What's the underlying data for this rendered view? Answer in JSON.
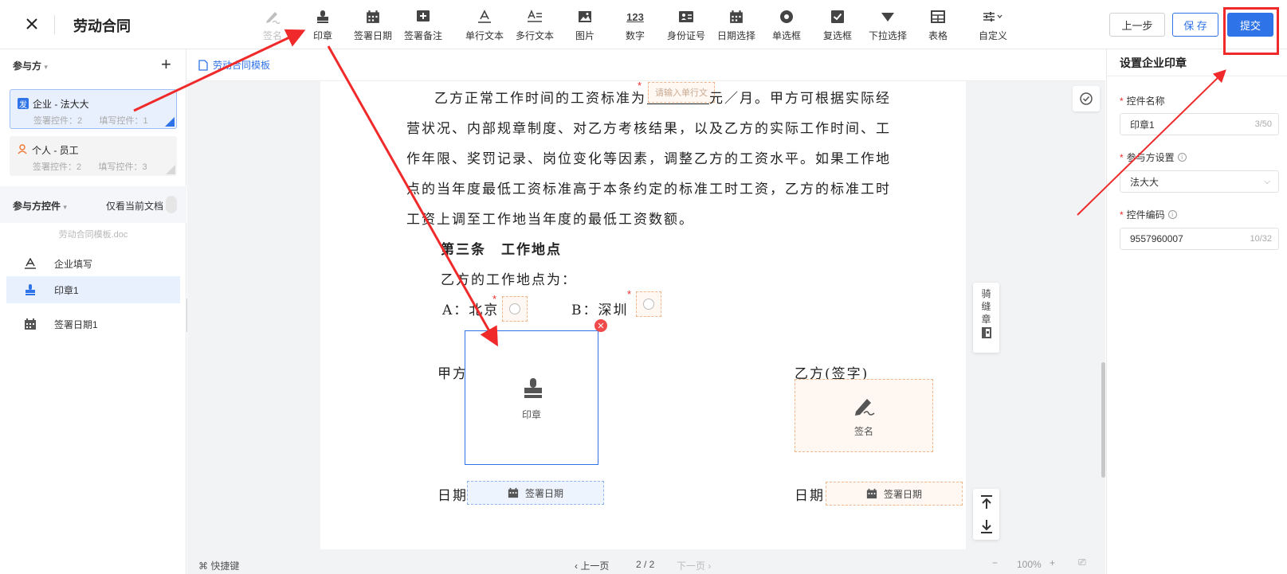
{
  "header": {
    "title": "劳动合同",
    "prev": "上一步",
    "save": "保 存",
    "submit": "提交"
  },
  "toolbar": [
    {
      "label": "签名",
      "icon": "pen-icon",
      "disabled": true
    },
    {
      "label": "印章",
      "icon": "stamp-icon"
    },
    {
      "label": "签署日期",
      "icon": "calendar-icon"
    },
    {
      "label": "签署备注",
      "icon": "plus-box-icon"
    },
    {
      "label": "单行文本",
      "icon": "single-line-text-icon"
    },
    {
      "label": "多行文本",
      "icon": "multi-line-text-icon"
    },
    {
      "label": "图片",
      "icon": "image-icon"
    },
    {
      "label": "数字",
      "icon": "number-icon",
      "glyph": "123"
    },
    {
      "label": "身份证号",
      "icon": "id-card-icon"
    },
    {
      "label": "日期选择",
      "icon": "calendar-icon"
    },
    {
      "label": "单选框",
      "icon": "radio-icon"
    },
    {
      "label": "复选框",
      "icon": "checkbox-icon"
    },
    {
      "label": "下拉选择",
      "icon": "dropdown-icon"
    },
    {
      "label": "表格",
      "icon": "table-icon"
    },
    {
      "label": "自定义",
      "icon": "custom-icon"
    }
  ],
  "sidebar": {
    "participants_title": "参与方",
    "participants": [
      {
        "tag": "发",
        "name": "企业 - 法大大",
        "sign_count": "签署控件：2",
        "fill_count": "填写控件：1"
      },
      {
        "name": "个人 - 员工",
        "sign_count": "签署控件：2",
        "fill_count": "填写控件：3"
      }
    ],
    "controls_title": "参与方控件",
    "only_current": "仅看当前文档",
    "doc_name": "劳动合同模板.doc",
    "controls": [
      {
        "label": "企业填写",
        "icon": "text-icon"
      },
      {
        "label": "印章1",
        "icon": "stamp-icon"
      },
      {
        "label": "签署日期1",
        "icon": "calendar-icon"
      }
    ]
  },
  "tab": {
    "label": "劳动合同模板"
  },
  "document": {
    "lines": [
      "乙方正常工作时间的工资标准为",
      "营状况、内部规章制度、对乙方考核结果，以及乙方的实际工作时间、工",
      "作年限、奖罚记录、岗位变化等因素，调整乙方的工资水平。如果工作地",
      "点的当年度最低工资标准高于本条约定的标准工时工资，乙方的标准工时",
      "工资上调至工作地当年度的最低工资数额。"
    ],
    "line1_tail": "元／月。甲方可根据实际经",
    "placeholder": "请输入单行文",
    "article": "第三条　工作地点",
    "place_intro": "乙方的工作地点为：",
    "option_a": "A：北京",
    "option_b": "B：深圳",
    "party_a": "甲方",
    "party_b": "乙方(签字)",
    "date_a": "日期",
    "date_b": "日期",
    "stamp_label": "印章",
    "sign_label": "签名",
    "date_field_a": "签署日期",
    "date_field_b": "签署日期",
    "riding_seal": "骑缝章"
  },
  "bottom": {
    "shortcut": "快捷键",
    "prev_page": "上一页",
    "page": "2 / 2",
    "next_page": "下一页",
    "zoom": "100%"
  },
  "rpanel": {
    "title": "设置企业印章",
    "name_label": "控件名称",
    "name_value": "印章1",
    "name_count": "3/50",
    "party_label": "参与方设置",
    "party_value": "法大大",
    "code_label": "控件编码",
    "code_value": "9557960007",
    "code_count": "10/32"
  },
  "colors": {
    "accent": "#2f73e8",
    "annotation": "#f02a2a",
    "warn_fill": "#fff8f2"
  }
}
